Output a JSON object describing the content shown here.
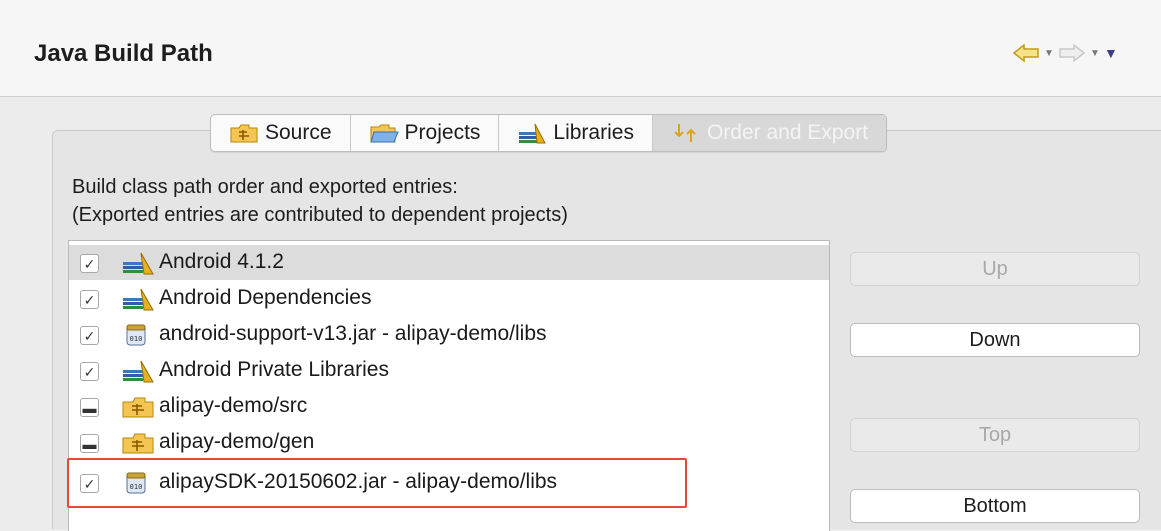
{
  "header": {
    "title": "Java Build Path"
  },
  "tabs": [
    {
      "label": "Source",
      "icon": "source-folder-icon",
      "active": false
    },
    {
      "label": "Projects",
      "icon": "projects-folder-icon",
      "active": false
    },
    {
      "label": "Libraries",
      "icon": "libraries-icon",
      "active": false
    },
    {
      "label": "Order and Export",
      "icon": "order-export-icon",
      "active": true
    }
  ],
  "description": {
    "line1": "Build class path order and exported entries:",
    "line2": "(Exported entries are contributed to dependent projects)"
  },
  "entries": [
    {
      "label": "Android 4.1.2",
      "icon": "library-icon",
      "state": "checked"
    },
    {
      "label": "Android Dependencies",
      "icon": "library-icon",
      "state": "checked"
    },
    {
      "label": "android-support-v13.jar - alipay-demo/libs",
      "icon": "jar-icon",
      "state": "checked"
    },
    {
      "label": "Android Private Libraries",
      "icon": "library-icon",
      "state": "checked"
    },
    {
      "label": "alipay-demo/src",
      "icon": "source-folder-icon",
      "state": "mixed"
    },
    {
      "label": "alipay-demo/gen",
      "icon": "source-folder-icon",
      "state": "mixed"
    },
    {
      "label": "alipaySDK-20150602.jar - alipay-demo/libs",
      "icon": "jar-icon",
      "state": "checked"
    }
  ],
  "buttons": {
    "up": "Up",
    "down": "Down",
    "top": "Top",
    "bottom": "Bottom"
  },
  "colors": {
    "highlight": "#e24b3b",
    "selection": "#dcdcdc"
  }
}
